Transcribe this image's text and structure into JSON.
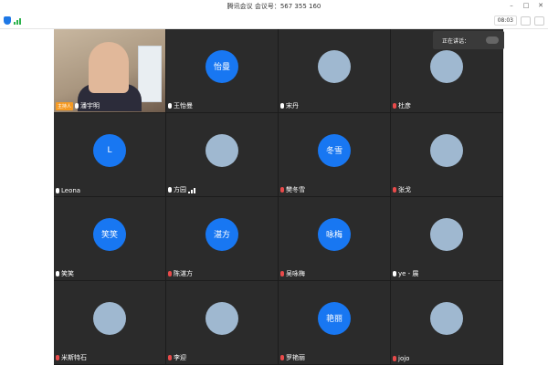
{
  "window": {
    "title": "腾讯会议 会议号：567 355 160"
  },
  "toolbar": {
    "time": "08:03"
  },
  "speaking_toast": {
    "label": "正在讲话："
  },
  "tiles": [
    {
      "name": "潘宇明",
      "type": "video",
      "muted": false,
      "host": true,
      "host_label": "主持人"
    },
    {
      "name": "王怡曼",
      "type": "initials",
      "initials": "怡曼",
      "muted": false
    },
    {
      "name": "宋丹",
      "type": "photo",
      "muted": false
    },
    {
      "name": "杜彦",
      "type": "photo",
      "muted": true
    },
    {
      "name": "Leona",
      "type": "initials",
      "initials": "L",
      "muted": false
    },
    {
      "name": "方园",
      "type": "photo",
      "muted": false,
      "signal": true
    },
    {
      "name": "樊冬雪",
      "type": "initials",
      "initials": "冬雪",
      "muted": true
    },
    {
      "name": "张戈",
      "type": "photo",
      "muted": true
    },
    {
      "name": "笑笑",
      "type": "initials",
      "initials": "笑笑",
      "muted": false
    },
    {
      "name": "陈湛方",
      "type": "initials",
      "initials": "湛方",
      "muted": true
    },
    {
      "name": "吴咏梅",
      "type": "initials",
      "initials": "咏梅",
      "muted": true
    },
    {
      "name": "ye - 展",
      "type": "photo",
      "muted": false
    },
    {
      "name": "米斯特石",
      "type": "photo",
      "muted": true
    },
    {
      "name": "李迎",
      "type": "photo",
      "muted": true
    },
    {
      "name": "罗艳丽",
      "type": "initials",
      "initials": "艳丽",
      "muted": true
    },
    {
      "name": "jojo",
      "type": "photo",
      "muted": true
    }
  ],
  "colors": {
    "avatar_blue": "#1877f2",
    "tile_bg": "#2b2b2b",
    "muted_red": "#e84a4a",
    "host_orange": "#f59a23"
  }
}
